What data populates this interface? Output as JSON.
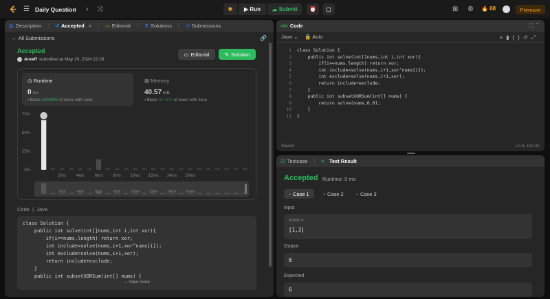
{
  "topbar": {
    "title": "Daily Question",
    "run_label": "Run",
    "submit_label": "Submit",
    "streak_count": "68",
    "premium_label": "Premium"
  },
  "left_tabs": [
    {
      "label": "Description"
    },
    {
      "label": "Accepted"
    },
    {
      "label": "Editorial"
    },
    {
      "label": "Solutions"
    },
    {
      "label": "Submissions"
    }
  ],
  "submission": {
    "back_label": "All Submissions",
    "status": "Accepted",
    "author": "Areeff",
    "submitted_text": "submitted at May 20, 2024 22:28",
    "editorial_btn": "Editorial",
    "solution_btn": "Solution"
  },
  "runtime": {
    "title": "Runtime",
    "value": "0",
    "unit": "ms",
    "beats_prefix": "Beats",
    "beats_pct": "100.00%",
    "beats_suffix": "of users with Java"
  },
  "memory": {
    "title": "Memory",
    "value": "40.57",
    "unit": "MB",
    "beats_prefix": "Beats",
    "beats_pct": "82.48%",
    "beats_suffix": "of users with Java"
  },
  "chart_data": {
    "type": "bar",
    "y_ticks": [
      "75%",
      "50%",
      "25%",
      "0%"
    ],
    "ylim": [
      0,
      75
    ],
    "x_ticks": [
      "2ms",
      "4ms",
      "6ms",
      "8ms",
      "10ms",
      "12ms",
      "14ms",
      "16ms"
    ],
    "values": [
      72,
      2,
      2,
      2,
      2,
      2,
      14,
      2,
      2,
      2,
      2,
      2,
      2,
      2,
      2,
      2,
      2,
      2,
      2,
      2,
      2,
      2,
      2
    ],
    "highlight_index": 0
  },
  "code_section": {
    "label": "Code",
    "lang": "Java",
    "view_more": "View more",
    "lines": [
      "class Solution {",
      "    public int solve(int[]nums,int i,int xor){",
      "        if(i==nums.length) return xor;",
      "        int include=solve(nums,i+1,xor^nums[i]);",
      "        int exclude=solve(nums,i+1,xor);",
      "        return include+exclude;",
      "    }",
      "    public int subsetXORSum(int[] nums) {"
    ]
  },
  "editor": {
    "title": "Code",
    "lang": "Java",
    "mode": "Auto",
    "saved": "Saved",
    "cursor": "Ln 6, Col 32",
    "lines": [
      "class Solution {",
      "    public int solve(int[]nums,int i,int xor){",
      "        if(i==nums.length) return xor;",
      "        int include=solve(nums,i+1,xor^nums[i]);",
      "        int exclude=solve(nums,i+1,xor);",
      "        return include+exclude;",
      "    }",
      "    public int subsetXORSum(int[] nums) {",
      "        return solve(nums,0,0);",
      "    }",
      "}"
    ]
  },
  "result": {
    "testcase_tab": "Testcase",
    "result_tab": "Test Result",
    "status": "Accepted",
    "runtime": "Runtime: 0 ms",
    "cases": [
      "Case 1",
      "Case 2",
      "Case 3"
    ],
    "input_label": "Input",
    "input_key": "nums =",
    "input_value": "[1,3]",
    "output_label": "Output",
    "output_value": "6",
    "expected_label": "Expected",
    "expected_value": "6"
  },
  "colors": {
    "accent_green": "#2cbb5d",
    "premium_orange": "#ffa116",
    "bar_grey": "#3e3e3e"
  }
}
